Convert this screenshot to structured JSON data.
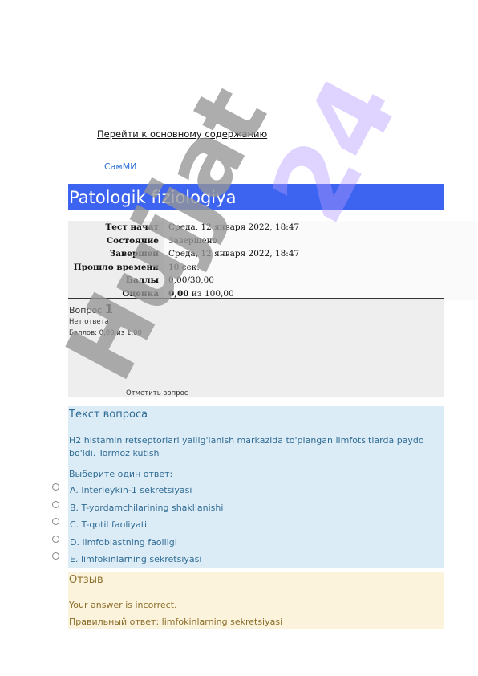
{
  "nav": {
    "skip_link": "Перейти к основному содержанию",
    "site_name": "СамМИ"
  },
  "course": {
    "title": "Patologik fiziologiya"
  },
  "summary": [
    {
      "label": "Тест начат",
      "value": "Среда, 12 января 2022, 18:47"
    },
    {
      "label": "Состояние",
      "value": "Завершено"
    },
    {
      "label": "Завершен",
      "value": "Среда, 12 января 2022, 18:47"
    },
    {
      "label": "Прошло времени",
      "value": "10 сек."
    },
    {
      "label": "Баллы",
      "value": "0,00/30,00"
    },
    {
      "label": "Оценка",
      "value_bold": "0,00",
      "value_rest": " из 100,00"
    }
  ],
  "question": {
    "label": "Вопрос",
    "number": "1",
    "state": "Нет ответа",
    "grade": "Баллов: 0,00 из 1,00",
    "flag": "Отметить вопрос",
    "heading": "Текст вопроса",
    "text": "H2 histamin retseptorlari yailig'lanish markazida to'plangan limfotsitlarda paydo bo'ldi. Tormoz kutish",
    "prompt": "Выберите один ответ:",
    "answers": [
      "A. Interleykin-1 sekretsiyasi",
      "B. T-yordamchilarining shakllanishi",
      "C. T-qotil faoliyati",
      "D. limfoblastning faolligi",
      "E. limfokinlarning sekretsiyasi"
    ]
  },
  "feedback": {
    "heading": "Отзыв",
    "result": "Your answer is incorrect.",
    "right_answer": "Правильный ответ: limfokinlarning sekretsiyasi"
  },
  "watermark": {
    "text_gray": "Hujjat",
    "text_purple": "24"
  },
  "colors": {
    "header_blue": "#3d64f0",
    "question_bg": "#dcecf6",
    "feedback_bg": "#fcf3dc"
  }
}
